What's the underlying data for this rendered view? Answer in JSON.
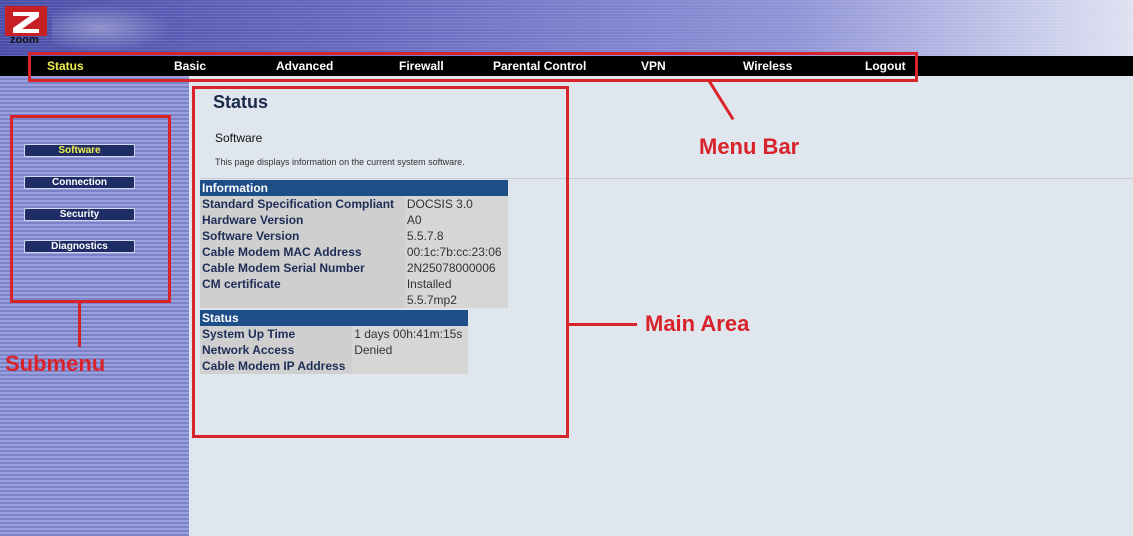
{
  "header": {
    "logo_text": "zoom"
  },
  "menu": {
    "items": [
      {
        "label": "Status",
        "active": true
      },
      {
        "label": "Basic"
      },
      {
        "label": "Advanced"
      },
      {
        "label": "Firewall"
      },
      {
        "label": "Parental Control"
      },
      {
        "label": "VPN"
      },
      {
        "label": "Wireless"
      },
      {
        "label": "Logout"
      }
    ]
  },
  "submenu": {
    "items": [
      {
        "label": "Software",
        "active": true
      },
      {
        "label": "Connection"
      },
      {
        "label": "Security"
      },
      {
        "label": "Diagnostics"
      }
    ]
  },
  "main": {
    "title": "Status",
    "section": "Software",
    "description": "This page displays information on the current system software.",
    "information": {
      "header": "Information",
      "rows": [
        {
          "label": "Standard Specification Compliant",
          "value": "DOCSIS 3.0"
        },
        {
          "label": "Hardware Version",
          "value": "A0"
        },
        {
          "label": "Software Version",
          "value": "5.5.7.8"
        },
        {
          "label": "Cable Modem MAC Address",
          "value": "00:1c:7b:cc:23:06"
        },
        {
          "label": "Cable Modem Serial Number",
          "value": "2N25078000006"
        },
        {
          "label": "CM certificate",
          "value": "Installed"
        },
        {
          "label": "",
          "value": "5.5.7mp2"
        }
      ]
    },
    "status": {
      "header": "Status",
      "rows": [
        {
          "label": "System Up Time",
          "value": "1 days 00h:41m:15s"
        },
        {
          "label": "Network Access",
          "value": "Denied"
        },
        {
          "label": "Cable Modem IP Address",
          "value": ""
        }
      ]
    }
  },
  "annotations": {
    "menu_bar": "Menu Bar",
    "main_area": "Main Area",
    "submenu": "Submenu",
    "color": "#d9232a"
  },
  "colors": {
    "menu_active": "#f1ef4d",
    "table_header": "#1d4e88",
    "sidebar": "#8a90d2"
  }
}
